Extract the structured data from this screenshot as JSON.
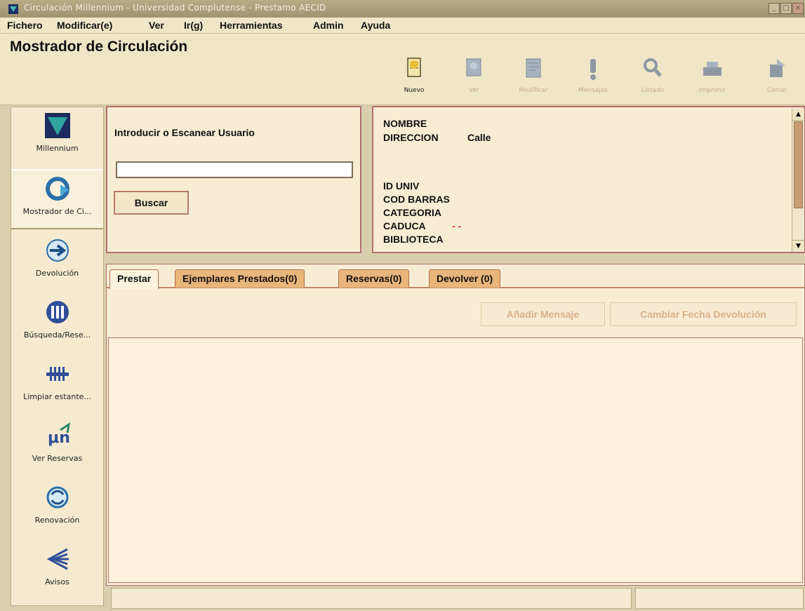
{
  "window": {
    "title": "Circulación Millennium - Universidad Complutense - Prestamo AECID",
    "controls": [
      "minimize",
      "maximize",
      "close"
    ]
  },
  "menu": [
    "Fichero",
    "Modificar(e)",
    "Ver",
    "Ir(g)",
    "Herramientas",
    "Admin",
    "Ayuda"
  ],
  "header": {
    "title": "Mostrador de Circulación"
  },
  "toolbar": {
    "nuevo": "Nuevo",
    "ver": "Ver",
    "modificar": "Modificar",
    "mensajes": "Mensajes",
    "listado": "Listado",
    "imprimir": "Imprimir",
    "cerrar": "Cerrar"
  },
  "sidebar": {
    "items": [
      {
        "label": "Millennium"
      },
      {
        "label": "Mostrador de Ci..."
      },
      {
        "label": "Devolución"
      },
      {
        "label": "Búsqueda/Rese..."
      },
      {
        "label": "Limpiar estante..."
      },
      {
        "label": "Ver Reservas"
      },
      {
        "label": "Renovación"
      },
      {
        "label": "Avisos"
      }
    ]
  },
  "search": {
    "prompt": "Introducir o Escanear Usuario",
    "value": "",
    "button": "Buscar"
  },
  "patron": {
    "nombre_label": "NOMBRE",
    "direccion_label": "DIRECCION",
    "direccion_value": "Calle",
    "id_label": "ID UNIV",
    "barcode_label": "COD BARRAS",
    "categoria_label": "CATEGORIA",
    "caduca_label": "CADUCA",
    "caduca_value": "- -",
    "biblioteca_label": "BIBLIOTECA"
  },
  "tabs": [
    {
      "label": "Prestar",
      "active": true
    },
    {
      "label": "Ejemplares Prestados(0)"
    },
    {
      "label": "Reservas(0)"
    },
    {
      "label": "Devolver (0)"
    }
  ],
  "actions": {
    "add_message": "Añadir Mensaje",
    "change_due_date": "Cambiar Fecha Devolución"
  },
  "colors": {
    "panel_border": "#b07070",
    "tab_inactive": "#e8b57a",
    "disabled_text": "#d9b08a",
    "scroll_thumb": "#c99e76",
    "caduca_value_color": "#e03030"
  }
}
